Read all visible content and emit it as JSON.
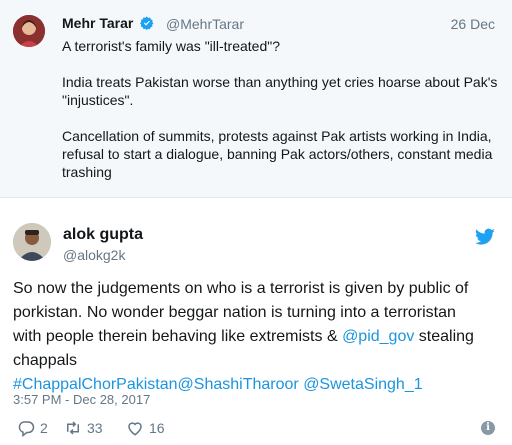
{
  "parent_tweet": {
    "author_name": "Mehr Tarar",
    "author_handle": "@MehrTarar",
    "date": "26 Dec",
    "paragraphs": [
      "A terrorist's family was \"ill-treated\"?",
      "India treats Pakistan worse than anything yet cries hoarse about Pak's \"injustices\".",
      "Cancellation of summits, protests against Pak artists working in India, refusal to start a dialogue, banning Pak actors/others, constant media trashing"
    ]
  },
  "tweet": {
    "author_name": "alok gupta",
    "author_handle": "@alokg2k",
    "text_part1": "So now the judgements on who is a terrorist is given by public of porkistan. No wonder beggar nation is turning into a terroristan with people therein behaving like extremists & ",
    "mention_pid": "@pid_gov",
    "text_part2": " stealing chappals",
    "hashtag": "#ChappalChorPakistan",
    "mention_shashi": "@ShashiTharoor",
    "mention_sweta": "@SwetaSingh_1",
    "timestamp": "3:57 PM - Dec 28, 2017",
    "reply_count": "2",
    "retweet_count": "33",
    "like_count": "16"
  },
  "colors": {
    "link": "#1b95e0",
    "muted": "#657786",
    "verified": "#1da1f2",
    "quoted_background": "#f5f8fa"
  },
  "icons": {
    "verified": "verified-badge-icon",
    "logo": "twitter-bird-icon",
    "reply": "reply-icon",
    "retweet": "retweet-icon",
    "like": "heart-icon",
    "info": "info-icon"
  }
}
